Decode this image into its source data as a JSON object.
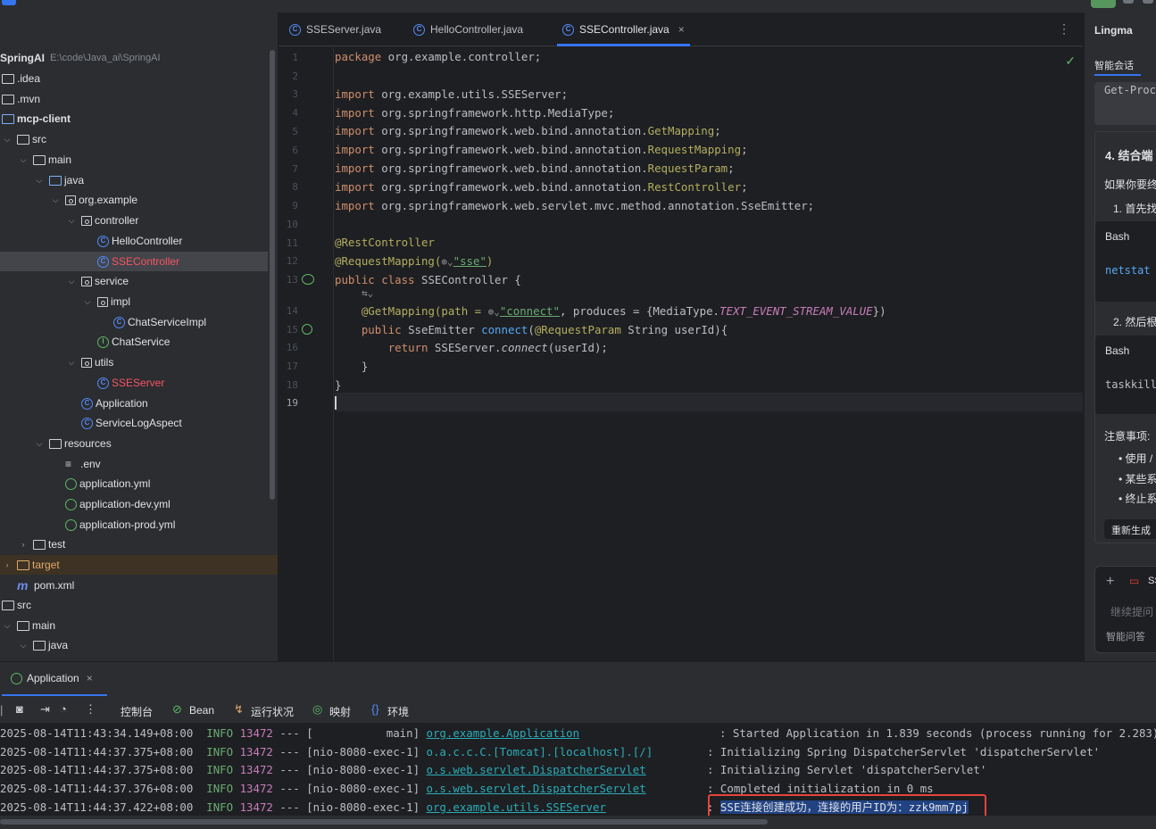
{
  "project": {
    "root_name": "SpringAI",
    "root_path": "E:\\code\\Java_ai\\SpringAI",
    "items": [
      {
        "label": "SpringAI",
        "icon": "project-root"
      },
      {
        "label": ".idea",
        "icon": "folder-icon"
      },
      {
        "label": ".mvn",
        "icon": "folder-icon"
      },
      {
        "label": "mcp-client",
        "icon": "module-folder-icon"
      },
      {
        "label": "src",
        "icon": "folder-icon"
      },
      {
        "label": "main",
        "icon": "folder-icon"
      },
      {
        "label": "java",
        "icon": "source-folder-icon"
      },
      {
        "label": "org.example",
        "icon": "package-icon"
      },
      {
        "label": "controller",
        "icon": "package-icon"
      },
      {
        "label": "HelloController",
        "icon": "class-icon"
      },
      {
        "label": "SSEController",
        "icon": "class-icon"
      },
      {
        "label": "service",
        "icon": "package-icon"
      },
      {
        "label": "impl",
        "icon": "package-icon"
      },
      {
        "label": "ChatServiceImpl",
        "icon": "class-icon"
      },
      {
        "label": "ChatService",
        "icon": "interface-icon"
      },
      {
        "label": "utils",
        "icon": "package-icon"
      },
      {
        "label": "SSEServer",
        "icon": "class-icon"
      },
      {
        "label": "Application",
        "icon": "spring-class-icon"
      },
      {
        "label": "ServiceLogAspect",
        "icon": "class-icon"
      },
      {
        "label": "resources",
        "icon": "resources-folder-icon"
      },
      {
        "label": ".env",
        "icon": "env-file-icon"
      },
      {
        "label": "application.yml",
        "icon": "spring-config-icon"
      },
      {
        "label": "application-dev.yml",
        "icon": "spring-config-icon"
      },
      {
        "label": "application-prod.yml",
        "icon": "spring-config-icon"
      },
      {
        "label": "test",
        "icon": "folder-icon"
      },
      {
        "label": "target",
        "icon": "excluded-folder-icon"
      },
      {
        "label": "pom.xml",
        "icon": "maven-icon"
      },
      {
        "label": "src",
        "icon": "folder-icon"
      },
      {
        "label": "main",
        "icon": "folder-icon"
      },
      {
        "label": "java",
        "icon": "folder-icon"
      }
    ]
  },
  "editor": {
    "tabs": [
      {
        "label": "SSEServer.java"
      },
      {
        "label": "HelloController.java"
      },
      {
        "label": "SSEController.java",
        "active": true
      }
    ],
    "line_numbers": [
      "1",
      "2",
      "3",
      "4",
      "5",
      "6",
      "7",
      "8",
      "9",
      "10",
      "11",
      "12",
      "13",
      "14",
      "15",
      "16",
      "17",
      "18",
      "19"
    ],
    "code": {
      "l1a": "package",
      "l1b": " org.example.controller;",
      "imp": "import",
      "l3": " org.example.utils.SSEServer;",
      "l4": " org.springframework.http.MediaType;",
      "l5a": " org.springframework.web.bind.annotation.",
      "l5b": "GetMapping",
      "l6a": " org.springframework.web.bind.annotation.",
      "l6b": "RequestMapping",
      "l7a": " org.springframework.web.bind.annotation.",
      "l7b": "RequestParam",
      "l8a": " org.springframework.web.bind.annotation.",
      "l8b": "RestController",
      "l9": " org.springframework.web.servlet.mvc.method.annotation.SseEmitter;",
      "l11": "@RestController",
      "l12a": "@RequestMapping(",
      "l12b": "\"sse\"",
      "l12c": ")",
      "l13a": "public class",
      "l13b": " SSEController {",
      "l14a": "@GetMapping(path = ",
      "l14b": "\"connect\"",
      "l14c": ", produces = {MediaType.",
      "l14d": "TEXT_EVENT_STREAM_VALUE",
      "l14e": "})",
      "l15a": "public",
      "l15b": " SseEmitter ",
      "l15c": "connect",
      "l15d": "(",
      "l15e": "@RequestParam",
      "l15f": " String userId){",
      "l16a": "return",
      "l16b": " SSEServer.",
      "l16c": "connect",
      "l16d": "(userId);",
      "l17": "}",
      "l18": "}"
    }
  },
  "right_panel": {
    "title": "Lingma",
    "tab": "智能会话",
    "t_getproc": "Get-Proc",
    "t_heading": "4. 结合端",
    "t_intro": "如果你要终",
    "t_step1": "1. 首先找",
    "t_bash1": "Bash",
    "t_netstat": "netstat",
    "t_step2": "2. 然后根",
    "t_bash2": "Bash",
    "t_taskkill": "taskkill",
    "t_notes": "注意事项:",
    "t_b1": "• 使用 /",
    "t_b2": "• 某些系",
    "t_b3": "• 终止系",
    "t_regen": "重新生成",
    "t_input_placeholder": "继续提问",
    "t_mode": "智能问答",
    "t_ss": "SS"
  },
  "bottom": {
    "run_tab": "Application",
    "toolbar": {
      "console": "控制台",
      "bean": "Bean",
      "health": "运行状况",
      "mappings": "映射",
      "env": "环境"
    },
    "logs": [
      {
        "ts": "2025-08-14T11:43:34.149+08:00",
        "level": "INFO",
        "pid": "13472",
        "sep": "---",
        "thread": "[           main]",
        "logger": "org.example.Application",
        "msg": ": Started Application in 1.839 seconds (process running for 2.283)"
      },
      {
        "ts": "2025-08-14T11:44:37.375+08:00",
        "level": "INFO",
        "pid": "13472",
        "sep": "---",
        "thread": "[nio-8080-exec-1]",
        "logger": "o.a.c.c.C.[Tomcat].[localhost].[/]",
        "msg": ": Initializing Spring DispatcherServlet 'dispatcherServlet'"
      },
      {
        "ts": "2025-08-14T11:44:37.375+08:00",
        "level": "INFO",
        "pid": "13472",
        "sep": "---",
        "thread": "[nio-8080-exec-1]",
        "logger": "o.s.web.servlet.DispatcherServlet",
        "msg": ": Initializing Servlet 'dispatcherServlet'"
      },
      {
        "ts": "2025-08-14T11:44:37.376+08:00",
        "level": "INFO",
        "pid": "13472",
        "sep": "---",
        "thread": "[nio-8080-exec-1]",
        "logger": "o.s.web.servlet.DispatcherServlet",
        "msg": ": Completed initialization in 0 ms"
      },
      {
        "ts": "2025-08-14T11:44:37.422+08:00",
        "level": "INFO",
        "pid": "13472",
        "sep": "---",
        "thread": "[nio-8080-exec-1]",
        "logger": "org.example.utils.SSEServer",
        "msg_pre": ": ",
        "msg_hl": "SSE连接创建成功，连接的用户ID为：zzk9mm7pj"
      }
    ]
  }
}
